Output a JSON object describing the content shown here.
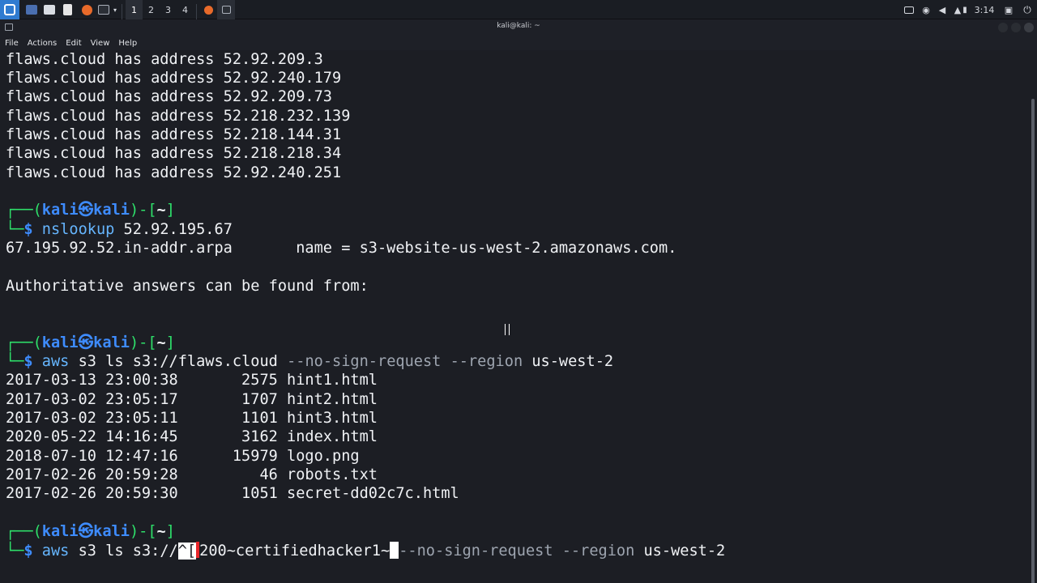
{
  "panel": {
    "workspaces": [
      "1",
      "2",
      "3",
      "4"
    ],
    "clock": "3:14",
    "colors": {
      "panel_bg": "#1a1d23",
      "kali_blue": "#2f7bd0"
    },
    "icons": [
      "kali-menu-icon",
      "desktop-icon",
      "file-manager-icon",
      "text-editor-icon",
      "firefox-icon",
      "terminal-icon",
      "chevron-down-icon",
      "firefox-task-icon",
      "terminal-task-icon",
      "display-icon",
      "network-icon",
      "volume-icon",
      "notification-icon",
      "battery-icon",
      "lock-icon",
      "power-icon"
    ]
  },
  "window": {
    "title": "kali@kali: ~"
  },
  "menu": {
    "file": "File",
    "actions": "Actions",
    "edit": "Edit",
    "view": "View",
    "help": "Help"
  },
  "terminal": {
    "host_lines": [
      "flaws.cloud has address 52.92.209.3",
      "flaws.cloud has address 52.92.240.179",
      "flaws.cloud has address 52.92.209.73",
      "flaws.cloud has address 52.218.232.139",
      "flaws.cloud has address 52.218.144.31",
      "flaws.cloud has address 52.218.218.34",
      "flaws.cloud has address 52.92.240.251"
    ],
    "prompt": {
      "top_left": "┌──(",
      "user": "kali",
      "at_symbol": "㉿",
      "host": "kali",
      "mid": ")-[",
      "dir": "~",
      "close": "]",
      "bottom_left": "└─",
      "dollar": "$"
    },
    "cmd1": {
      "name": "nslookup",
      "args": " 52.92.195.67"
    },
    "nslookup_result": "67.195.92.52.in-addr.arpa       name = s3-website-us-west-2.amazonaws.com.",
    "authoritative": "Authoritative answers can be found from:",
    "cmd2": {
      "name": "aws",
      "args1": " s3 ls s3://flaws.cloud ",
      "opt1": "--no-sign-request",
      "sp": " ",
      "opt2": "--region",
      "args2": " us-west-2"
    },
    "listing": [
      "2017-03-13 23:00:38       2575 hint1.html",
      "2017-03-02 23:05:17       1707 hint2.html",
      "2017-03-02 23:05:11       1101 hint3.html",
      "2020-05-22 14:16:45       3162 index.html",
      "2018-07-10 12:47:16      15979 logo.png",
      "2017-02-26 20:59:28         46 robots.txt",
      "2017-02-26 20:59:30       1051 secret-dd02c7c.html"
    ],
    "cmd3": {
      "name": "aws",
      "args1": " s3 ls s3://",
      "esc": "^[",
      "mid": "200~certifiedhacker1~",
      "opt1": "--no-sign-request",
      "sp": " ",
      "opt2": "--region",
      "args2": " us-west-2"
    },
    "colors": {
      "bg": "#1c1e24",
      "prompt_green": "#2ee06a",
      "prompt_blue": "#3e8cff",
      "command_blue": "#66b6ff",
      "option_gray": "#9ea5b0"
    }
  }
}
